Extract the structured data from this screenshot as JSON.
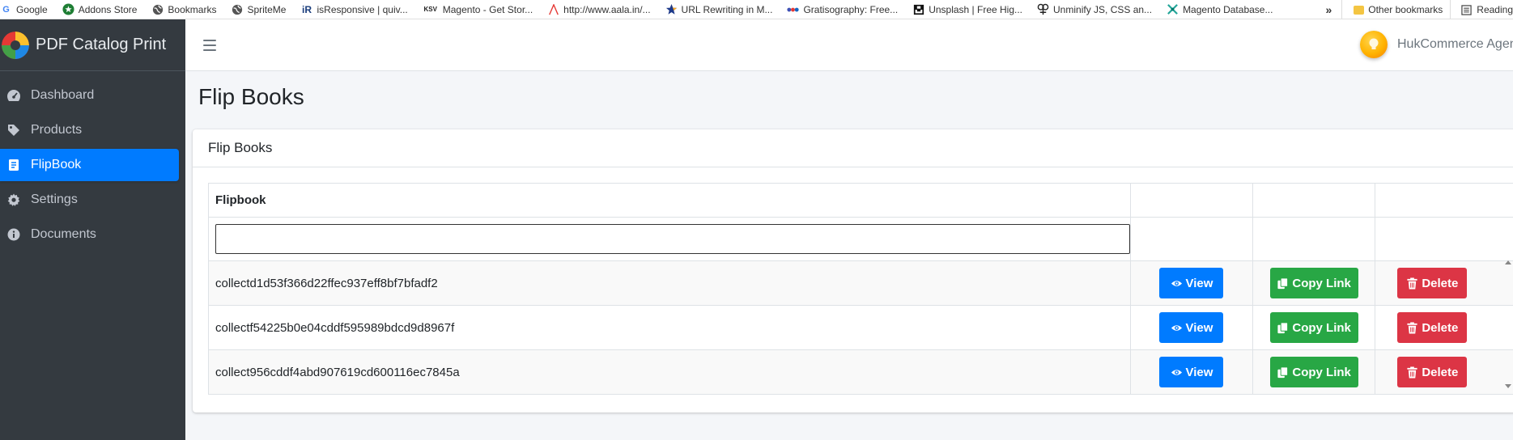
{
  "bookmarks": [
    {
      "label": "Google",
      "icon": "google-icon"
    },
    {
      "label": "Addons Store",
      "icon": "addons-icon"
    },
    {
      "label": "Bookmarks",
      "icon": "globe-icon"
    },
    {
      "label": "SpriteMe",
      "icon": "globe-icon"
    },
    {
      "label": "isResponsive | quiv...",
      "icon": "ir-icon"
    },
    {
      "label": "Magento - Get Stor...",
      "icon": "ksv-icon"
    },
    {
      "label": "http://www.aala.in/...",
      "icon": "aala-icon"
    },
    {
      "label": "URL Rewriting in M...",
      "icon": "star-icon"
    },
    {
      "label": "Gratisography: Free...",
      "icon": "dots-icon"
    },
    {
      "label": "Unsplash | Free Hig...",
      "icon": "unsplash-icon"
    },
    {
      "label": "Unminify JS, CSS an...",
      "icon": "unminify-icon"
    },
    {
      "label": "Magento Database...",
      "icon": "db-icon"
    }
  ],
  "bookmarks_overflow": "»",
  "bookmarks_other": "Other bookmarks",
  "bookmarks_reading": "Reading",
  "sidebar": {
    "brand": "PDF Catalog Print",
    "items": [
      {
        "label": "Dashboard",
        "icon": "dashboard-icon",
        "active": false
      },
      {
        "label": "Products",
        "icon": "tag-icon",
        "active": false
      },
      {
        "label": "FlipBook",
        "icon": "book-icon",
        "active": true
      },
      {
        "label": "Settings",
        "icon": "gear-icon",
        "active": false
      },
      {
        "label": "Documents",
        "icon": "info-icon",
        "active": false
      }
    ]
  },
  "topbar": {
    "user_name": "HukCommerce Agency"
  },
  "page": {
    "title": "Flip Books",
    "card_title": "Flip Books"
  },
  "table": {
    "header": "Flipbook",
    "filter_value": "",
    "rows": [
      {
        "name": "collectd1d53f366d22ffec937eff8bf7bfadf2"
      },
      {
        "name": "collectf54225b0e04cddf595989bdcd9d8967f"
      },
      {
        "name": "collect956cddf4abd907619cd600116ec7845a"
      }
    ],
    "view_label": "View",
    "copy_label": "Copy Link",
    "delete_label": "Delete"
  },
  "colors": {
    "sidebar_bg": "#343a40",
    "active": "#007bff",
    "view": "#007bff",
    "copy": "#28a745",
    "delete": "#dc3545"
  }
}
